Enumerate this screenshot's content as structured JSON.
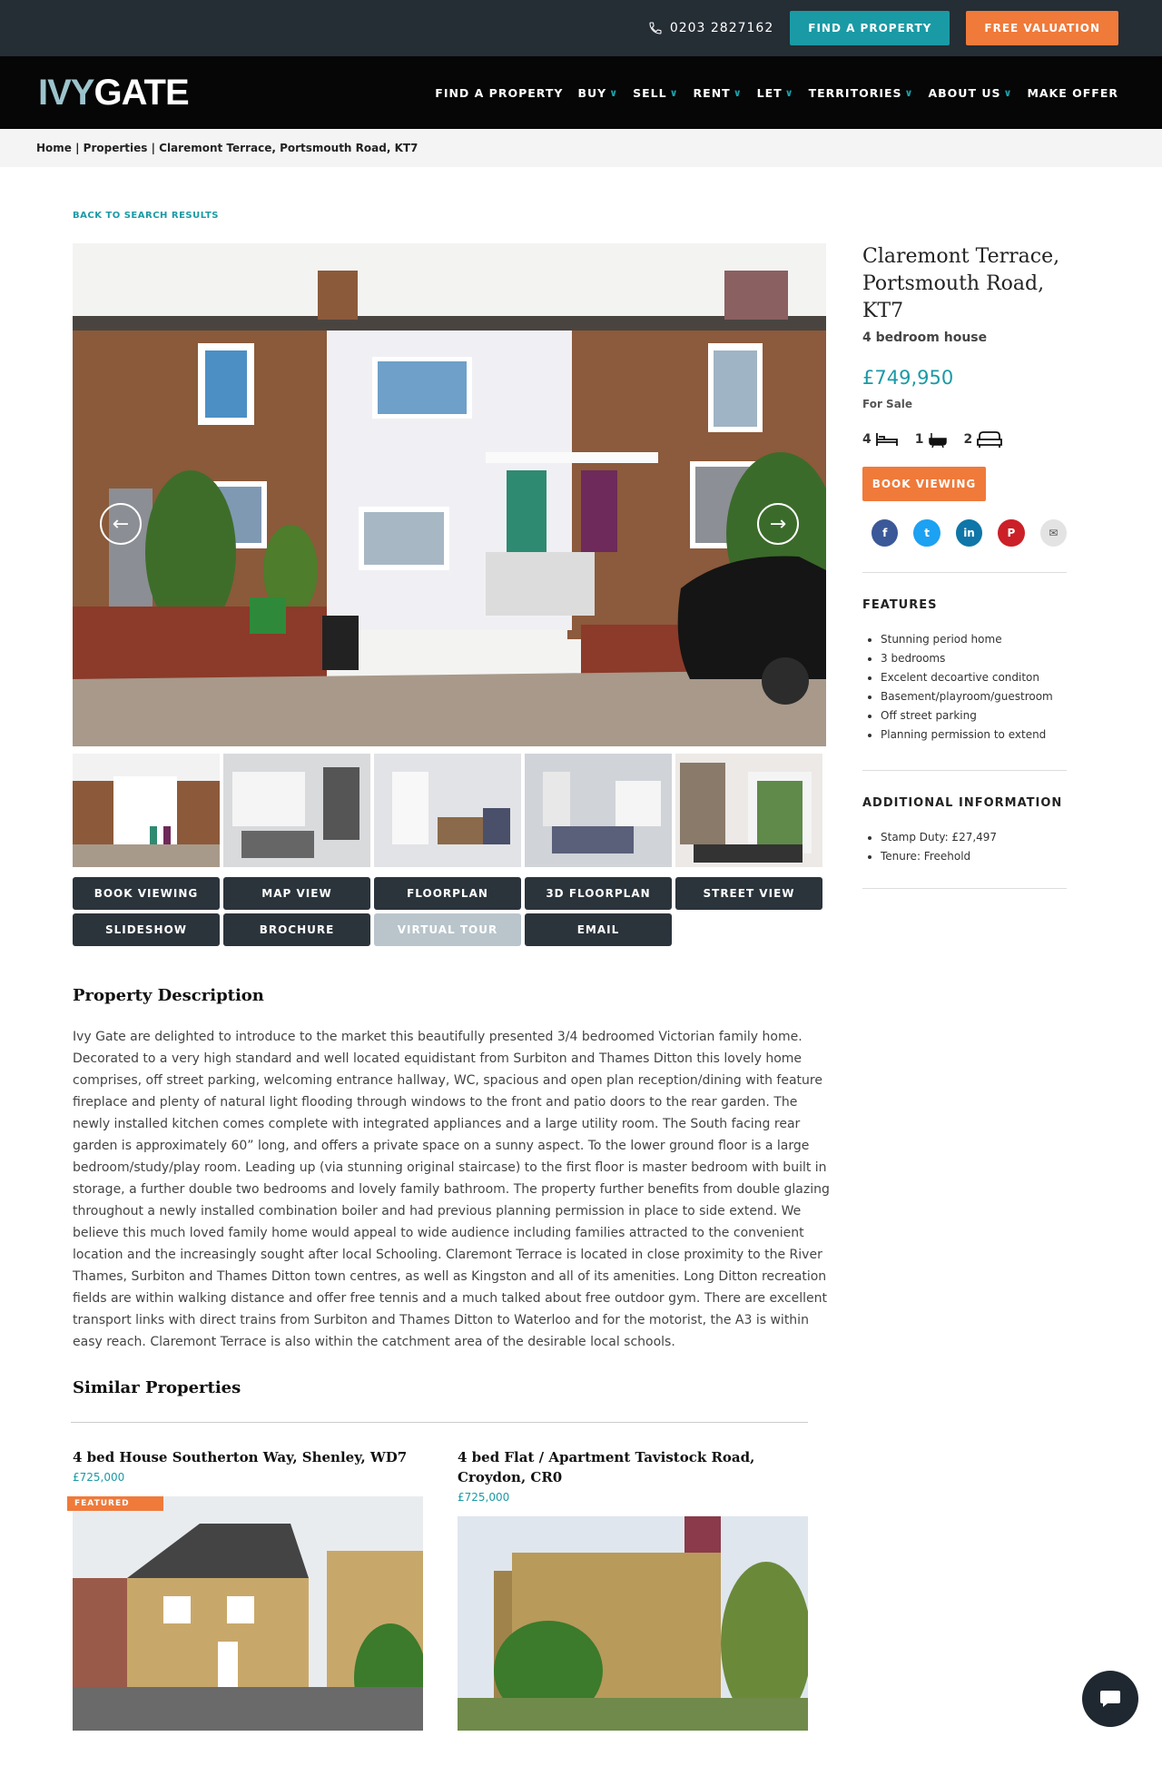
{
  "topbar": {
    "phone": "0203 2827162",
    "find_button": "FIND A PROPERTY",
    "valuation_button": "FREE VALUATION"
  },
  "brand": {
    "part1": "IVY",
    "part2": "GATE"
  },
  "nav": [
    {
      "label": "FIND A PROPERTY",
      "dropdown": false
    },
    {
      "label": "BUY",
      "dropdown": true
    },
    {
      "label": "SELL",
      "dropdown": true
    },
    {
      "label": "RENT",
      "dropdown": true
    },
    {
      "label": "LET",
      "dropdown": true
    },
    {
      "label": "TERRITORIES",
      "dropdown": true
    },
    {
      "label": "ABOUT US",
      "dropdown": true
    },
    {
      "label": "MAKE OFFER",
      "dropdown": false
    }
  ],
  "breadcrumb": "Home | Properties | Claremont Terrace, Portsmouth Road, KT7",
  "back_link": "BACK TO SEARCH RESULTS",
  "actions": [
    {
      "label": "BOOK VIEWING",
      "disabled": false
    },
    {
      "label": "MAP VIEW",
      "disabled": false
    },
    {
      "label": "FLOORPLAN",
      "disabled": false
    },
    {
      "label": "3D FLOORPLAN",
      "disabled": false
    },
    {
      "label": "STREET VIEW",
      "disabled": false
    },
    {
      "label": "SLIDESHOW",
      "disabled": false
    },
    {
      "label": "BROCHURE",
      "disabled": false
    },
    {
      "label": "VIRTUAL TOUR",
      "disabled": true
    },
    {
      "label": "EMAIL",
      "disabled": false
    }
  ],
  "property": {
    "title": "Claremont Terrace, Portsmouth Road, KT7",
    "type": "4 bedroom house",
    "price": "£749,950",
    "status": "For Sale",
    "bedrooms": "4",
    "bathrooms": "1",
    "receptions": "2",
    "book_button": "BOOK VIEWING"
  },
  "features_heading": "FEATURES",
  "features": [
    "Stunning period home",
    "3 bedrooms",
    "Excelent decoartive conditon",
    "Basement/playroom/guestroom",
    "Off street parking",
    "Planning permission to extend"
  ],
  "additional_heading": "ADDITIONAL INFORMATION",
  "additional": [
    "Stamp Duty: £27,497",
    "Tenure: Freehold"
  ],
  "description": {
    "heading": "Property Description",
    "text": "Ivy Gate are delighted to introduce to the market this beautifully presented 3/4 bedroomed Victorian family home. Decorated to a very high standard and well located equidistant from Surbiton and Thames Ditton this lovely home comprises, off street parking, welcoming entrance hallway, WC, spacious and open plan reception/dining with feature fireplace and plenty of natural light flooding through windows to the front and patio doors to the rear garden. The newly installed kitchen comes complete with integrated appliances and a large utility room. The South facing rear garden is approximately 60” long, and offers a private space on a sunny aspect. To the lower ground floor is a large bedroom/study/play room. Leading up (via stunning original staircase) to the first floor is master bedroom with built in storage, a further double two bedrooms and lovely family bathroom. The property further benefits from double glazing throughout a newly installed combination boiler and had previous planning permission in place to side extend. We believe this much loved family home would appeal to wide audience including families attracted to the convenient location and the increasingly sought after local Schooling. Claremont Terrace is located in close proximity to the River Thames, Surbiton and Thames Ditton town centres, as well as Kingston and all of its amenities. Long Ditton recreation fields are within walking distance and offer free tennis and a much talked about free outdoor gym. There are excellent transport links with direct trains from Surbiton and Thames Ditton to Waterloo and for the motorist, the A3 is within easy reach. Claremont Terrace is also within the catchment area of the desirable local schools."
  },
  "similar": {
    "heading": "Similar Properties",
    "items": [
      {
        "title": "4 bed House Southerton Way, Shenley, WD7",
        "price": "£725,000",
        "badge": "FEATURED"
      },
      {
        "title": "4 bed Flat / Apartment Tavistock Road, Croydon, CR0",
        "price": "£725,000"
      }
    ]
  },
  "colors": {
    "teal": "#1a9aa5",
    "orange": "#ef7a3a",
    "dark": "#252d35"
  },
  "icons": [
    "phone-icon",
    "bed-icon",
    "bath-icon",
    "sofa-icon",
    "facebook-icon",
    "twitter-icon",
    "linkedin-icon",
    "pinterest-icon",
    "email-icon",
    "chat-icon",
    "arrow-left-icon",
    "arrow-right-icon"
  ]
}
